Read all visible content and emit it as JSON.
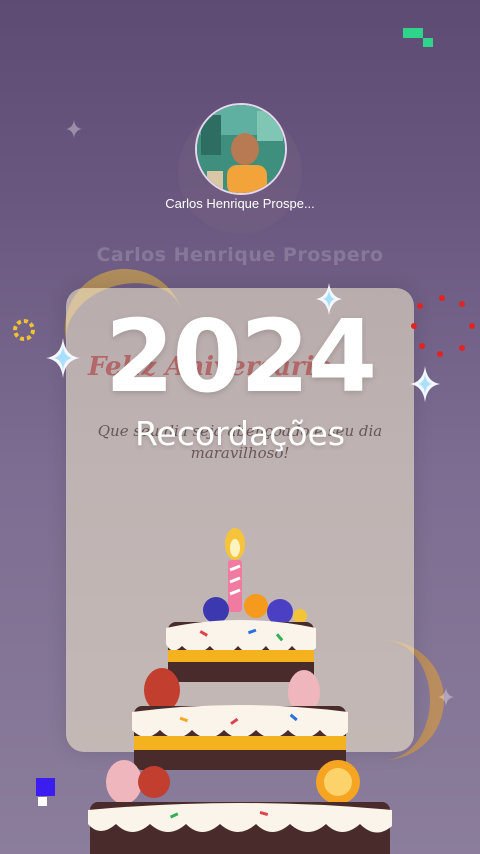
{
  "profile": {
    "name": "Carlos Henrique Prospe...",
    "background_name": "Carlos Henrique Prospero"
  },
  "highlight": {
    "year": "2024",
    "subtitle": "Recordações"
  },
  "card": {
    "title": "Feliz Aniversário",
    "message_line1": "Que seu dia seja abençoado e seu dia",
    "message_line2": "maravilhoso!"
  },
  "colors": {
    "background_top": "#5d4b73",
    "background_bottom": "#8b7d9b",
    "accent_green": "#2fd38a",
    "accent_blue": "#3b1df0",
    "accent_yellow": "#f2c230",
    "accent_red": "#e02424"
  }
}
